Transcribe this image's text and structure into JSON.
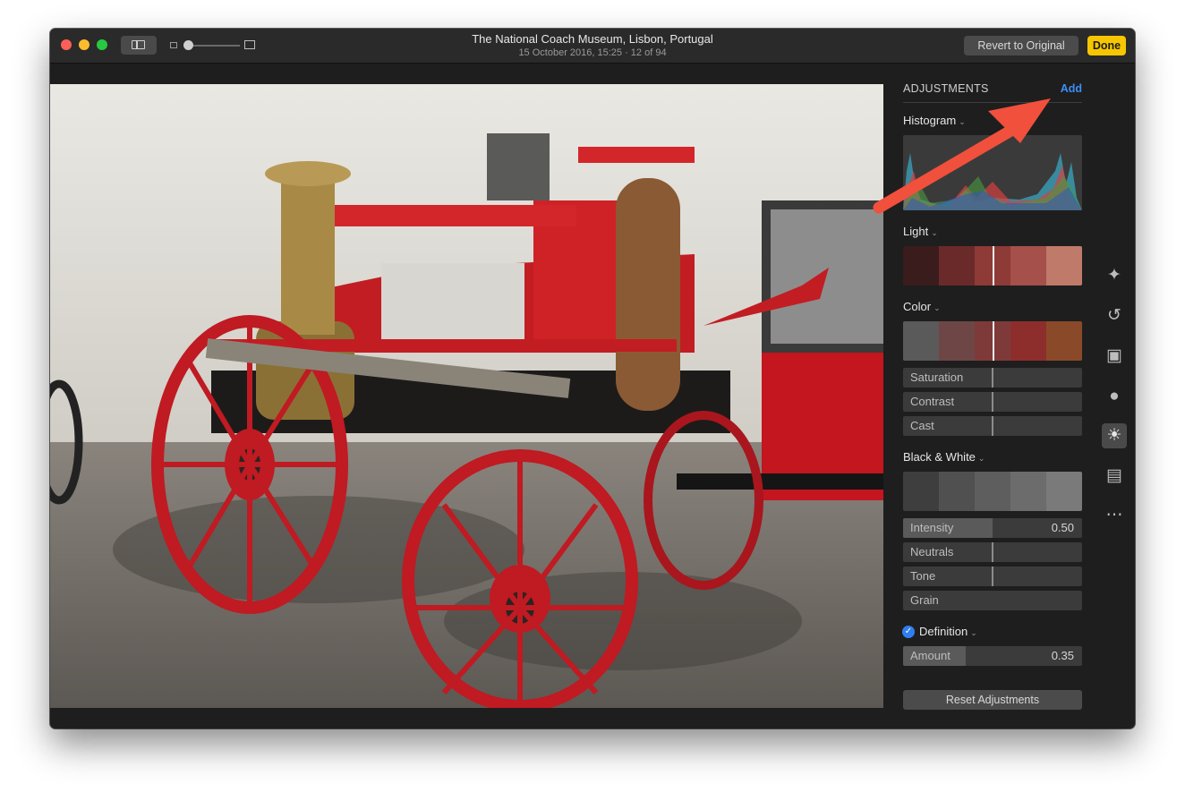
{
  "window": {
    "title": "The National Coach Museum, Lisbon, Portugal",
    "subtitle": "15 October 2016, 15:25 · 12 of 94",
    "revert_label": "Revert to Original",
    "done_label": "Done",
    "zoom_level": 0.05
  },
  "adjustments": {
    "heading": "ADJUSTMENTS",
    "add_label": "Add",
    "histogram_label": "Histogram",
    "light_label": "Light",
    "color_label": "Color",
    "color_sliders": [
      {
        "label": "Saturation",
        "value": 0.5
      },
      {
        "label": "Contrast",
        "value": 0.5
      },
      {
        "label": "Cast",
        "value": 0.5
      }
    ],
    "bw_label": "Black & White",
    "bw_sliders": [
      {
        "label": "Intensity",
        "value_text": "0.50",
        "fill": 0.5
      },
      {
        "label": "Neutrals",
        "fill": 0.5
      },
      {
        "label": "Tone",
        "fill": 0.5
      },
      {
        "label": "Grain",
        "fill": 0
      }
    ],
    "definition_label": "Definition",
    "definition_enabled": true,
    "amount_label": "Amount",
    "amount_value": "0.35",
    "amount_fill": 0.35,
    "reset_label": "Reset Adjustments"
  },
  "tools": [
    "magic-wand-icon",
    "rotate-icon",
    "crop-icon",
    "filters-icon",
    "adjust-icon",
    "retouch-icon",
    "more-icon"
  ],
  "colors": {
    "accent_blue": "#3b8ef5",
    "done_yellow": "#f6c700",
    "annotation_arrow": "#f0503c"
  }
}
